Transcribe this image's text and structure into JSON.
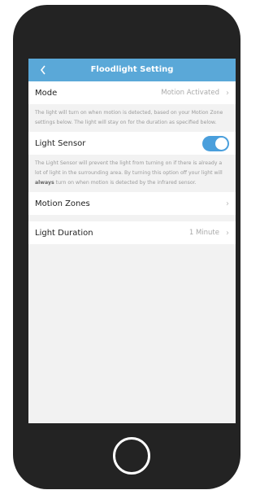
{
  "header": {
    "title": "Floodlight Setting",
    "back_icon": "chevron-left-icon"
  },
  "mode": {
    "label": "Mode",
    "value": "Motion Activated",
    "description": "The light will turn on when motion is detected, based on your Motion Zone settings below. The light will stay on for the duration as specified below."
  },
  "light_sensor": {
    "label": "Light Sensor",
    "enabled": true,
    "description_prefix": "The Light Sensor will prevent the light from turning on if there is already a lot of light in the surrounding area. By turning this option off your light will ",
    "description_bold": "always",
    "description_suffix": " turn on when motion is detected by the infrared sensor."
  },
  "motion_zones": {
    "label": "Motion Zones"
  },
  "light_duration": {
    "label": "Light Duration",
    "value": "1 Minute"
  },
  "colors": {
    "header": "#5aa8d8",
    "toggle_on": "#4a9fdc",
    "phone_body": "#232323"
  }
}
